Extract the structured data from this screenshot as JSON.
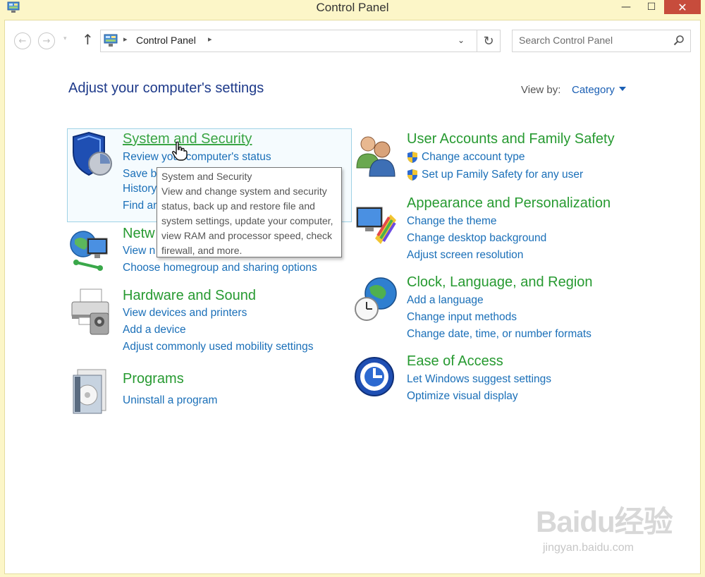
{
  "window": {
    "title": "Control Panel",
    "minimize_glyph": "—",
    "maximize_glyph": "☐",
    "close_glyph": "✕"
  },
  "addressbar": {
    "back_icon": "←",
    "forward_icon": "→",
    "recent_icon": "▾",
    "up_icon": "↑",
    "separator_glyph": "▸",
    "breadcrumb": "Control Panel",
    "dropdown_glyph": "⌄",
    "refresh_glyph": "↻",
    "search_placeholder": "Search Control Panel"
  },
  "header": {
    "title": "Adjust your computer's settings",
    "view_by_label": "View by:",
    "view_by_value": "Category"
  },
  "categories": {
    "system_security": {
      "title": "System and Security",
      "links": [
        "Review your computer's status",
        "Save ba",
        "History",
        "Find an"
      ]
    },
    "network": {
      "title": "Netw",
      "links": [
        "View n",
        "Choose homegroup and sharing options"
      ]
    },
    "hardware": {
      "title": "Hardware and Sound",
      "links": [
        "View devices and printers",
        "Add a device",
        "Adjust commonly used mobility settings"
      ]
    },
    "programs": {
      "title": "Programs",
      "links": [
        "Uninstall a program"
      ]
    },
    "user_accounts": {
      "title": "User Accounts and Family Safety",
      "links": [
        "Change account type",
        "Set up Family Safety for any user"
      ]
    },
    "appearance": {
      "title": "Appearance and Personalization",
      "links": [
        "Change the theme",
        "Change desktop background",
        "Adjust screen resolution"
      ]
    },
    "clock": {
      "title": "Clock, Language, and Region",
      "links": [
        "Add a language",
        "Change input methods",
        "Change date, time, or number formats"
      ]
    },
    "ease": {
      "title": "Ease of Access",
      "links": [
        "Let Windows suggest settings",
        "Optimize visual display"
      ]
    }
  },
  "tooltip": {
    "title": "System and Security",
    "description": "View and change system and security status, back up and restore file and system settings, update your computer, view RAM and processor speed, check firewall, and more."
  },
  "watermark": {
    "logo": "Baidu经验",
    "url": "jingyan.baidu.com"
  },
  "colors": {
    "category_title": "#279a31",
    "link": "#1a6fb8",
    "page_title": "#1e3a8a",
    "outer_frame": "#fcf6c8"
  },
  "icons": {
    "system_security": "shield-icon",
    "network": "network-globe-icon",
    "hardware": "printer-icon",
    "programs": "programs-disc-icon",
    "user_accounts": "users-icon",
    "appearance": "appearance-monitor-icon",
    "clock": "clock-globe-icon",
    "ease": "ease-of-access-icon"
  }
}
